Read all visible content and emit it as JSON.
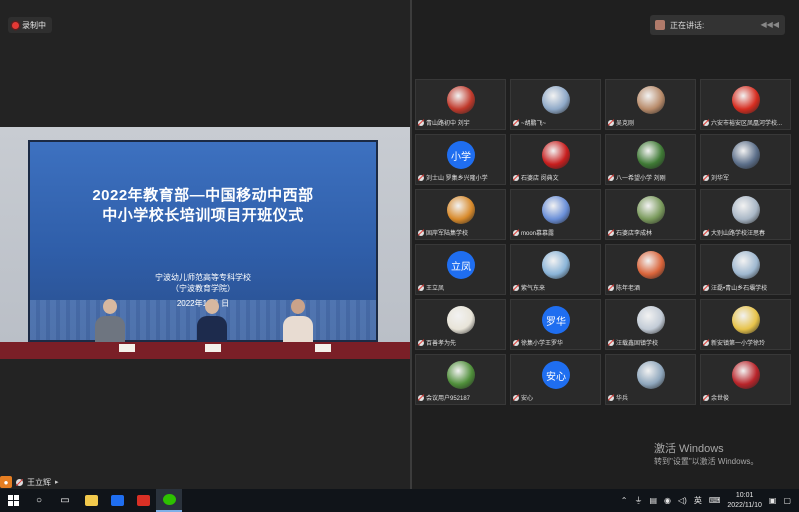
{
  "recording": {
    "label": "录制中"
  },
  "speaking": {
    "label": "正在讲话:"
  },
  "slide": {
    "title_line1": "2022年教育部—中国移动中西部",
    "title_line2": "中小学校长培训项目开班仪式",
    "org_line1": "宁波幼儿师范高等专科学校",
    "org_line2": "（宁波教育学院）",
    "date": "2022年11月 日"
  },
  "participants": [
    {
      "name": "青山路初中 刘宇",
      "avatar": "photo",
      "color": "#c0392b"
    },
    {
      "name": "~胡鹏飞~",
      "avatar": "photo",
      "color": "#8fa9c8"
    },
    {
      "name": "吴克刚",
      "avatar": "photo",
      "color": "#b88b6a"
    },
    {
      "name": "六安市裕安区凤凰河学校...",
      "avatar": "photo",
      "color": "#d62d20"
    },
    {
      "name": "刘士山 罗集乡兴隆小学",
      "avatar": "text",
      "text": "小学"
    },
    {
      "name": "石婆店 闵典文",
      "avatar": "photo",
      "color": "#c81e1e"
    },
    {
      "name": "八一希望小学 刘刚",
      "avatar": "photo",
      "color": "#3f7a35"
    },
    {
      "name": "刘华军",
      "avatar": "photo",
      "color": "#5c6f8a"
    },
    {
      "name": "固岸军陆集学校",
      "avatar": "photo",
      "color": "#d88a2b"
    },
    {
      "name": "moon慕慕露",
      "avatar": "photo",
      "color": "#6a8fd8"
    },
    {
      "name": "石婆店李成林",
      "avatar": "photo",
      "color": "#7a9a5c"
    },
    {
      "name": "大别山路学校汪思春",
      "avatar": "photo",
      "color": "#a9b7c6"
    },
    {
      "name": "王立凤",
      "avatar": "text",
      "text": "立凤"
    },
    {
      "name": "紫气东来",
      "avatar": "photo",
      "color": "#8ab4d8"
    },
    {
      "name": "陈年老酒",
      "avatar": "photo",
      "color": "#d9643a"
    },
    {
      "name": "汪磊•青山乡石壩学校",
      "avatar": "photo",
      "color": "#9fb8d0"
    },
    {
      "name": "百善孝为先",
      "avatar": "photo",
      "color": "#e8e4d8"
    },
    {
      "name": "徐集小学王罗华",
      "avatar": "text",
      "text": "罗华"
    },
    {
      "name": "汪载鑫固镇学校",
      "avatar": "photo",
      "color": "#c2cbd6"
    },
    {
      "name": "新安镇第一小学徐玲",
      "avatar": "photo",
      "color": "#e7c34a"
    },
    {
      "name": "会议用户952187",
      "avatar": "photo",
      "color": "#4f8f3a"
    },
    {
      "name": "安心",
      "avatar": "text",
      "text": "安心"
    },
    {
      "name": "华兵",
      "avatar": "photo",
      "color": "#8fa7bd"
    },
    {
      "name": "余世俊",
      "avatar": "photo",
      "color": "#b9242a"
    }
  ],
  "activation": {
    "line1": "激活 Windows",
    "line2": "转到\"设置\"以激活 Windows。"
  },
  "self": {
    "name": "王立辉"
  },
  "taskbar": {
    "ime": "英",
    "time": "10:01",
    "date": "2022/11/10"
  },
  "colors": {
    "accent_blue": "#1f6ef0",
    "record_red": "#e53935"
  }
}
